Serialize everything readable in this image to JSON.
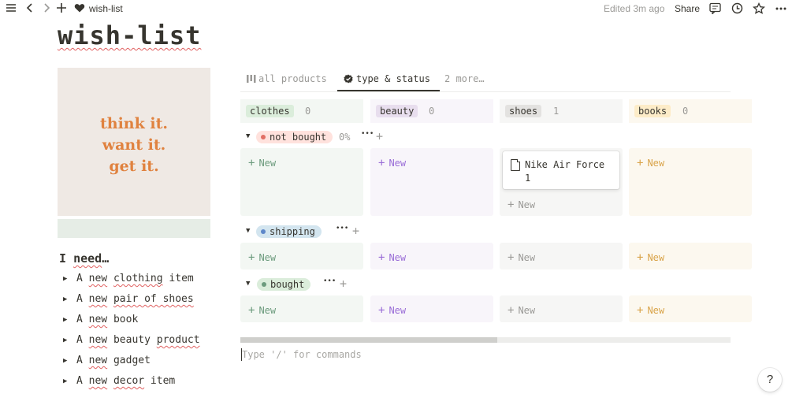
{
  "topbar": {
    "menu_icon": "hamburger-icon",
    "back_icon": "chevron-left-icon",
    "forward_icon": "chevron-right-icon",
    "add_icon": "plus-icon",
    "breadcrumb_icon": "heart-icon",
    "breadcrumb": "wish-list",
    "edited": "Edited 3m ago",
    "share": "Share",
    "comment_icon": "comment-icon",
    "history_icon": "clock-icon",
    "favorite_icon": "star-icon",
    "more_icon": "more-icon"
  },
  "page": {
    "title": "wish-list",
    "cover_lines": [
      "think it.",
      "want it.",
      "get it."
    ],
    "cover_color": "#e0823f"
  },
  "need": {
    "heading_prefix": "I ",
    "heading_word": "need",
    "heading_suffix": "…",
    "items": [
      {
        "a": "A ",
        "b": "new",
        "c": " ",
        "d": "clothing",
        "e": " item"
      },
      {
        "a": "A ",
        "b": "new",
        "c": " ",
        "d": "pair of shoes",
        "e": ""
      },
      {
        "a": "A ",
        "b": "new",
        "c": " book",
        "d": "",
        "e": ""
      },
      {
        "a": "A ",
        "b": "new",
        "c": " beauty ",
        "d": "product",
        "e": ""
      },
      {
        "a": "A ",
        "b": "new",
        "c": " gadget",
        "d": "",
        "e": ""
      },
      {
        "a": "A ",
        "b": "new",
        "c": " ",
        "d": "decor",
        "e": " item"
      }
    ]
  },
  "tabs": [
    {
      "label": "all products",
      "icon": "board-icon"
    },
    {
      "label": "type & status",
      "icon": "check-badge-icon"
    },
    {
      "label": "2 more…",
      "icon": ""
    }
  ],
  "columns": [
    {
      "label": "clothes",
      "count": "0",
      "pill": "#dbeddb",
      "bg": "#f3f7f3",
      "accent": "#6c9b7d"
    },
    {
      "label": "beauty",
      "count": "0",
      "pill": "#e8deee",
      "bg": "#f8f5fa",
      "accent": "#9a6dd7"
    },
    {
      "label": "shoes",
      "count": "1",
      "pill": "#e3e2e0",
      "bg": "#f6f6f5",
      "accent": "#9b9a97"
    },
    {
      "label": "books",
      "count": "0",
      "pill": "#fdecc8",
      "bg": "#fcf8ef",
      "accent": "#d9a44a"
    }
  ],
  "groups": [
    {
      "label": "not bought",
      "pct": "0%",
      "pill": "#ffe2dd",
      "dot": "#e16f64"
    },
    {
      "label": "shipping",
      "pct": "",
      "pill": "#d3e5ef",
      "dot": "#5e87c9"
    },
    {
      "label": "bought",
      "pct": "",
      "pill": "#dbeddb",
      "dot": "#6c9b7d"
    }
  ],
  "card": {
    "title": "Nike Air Force 1",
    "icon": "page-icon"
  },
  "new_label": "New",
  "group_more": "•••",
  "group_add": "+",
  "command_placeholder": "Type '/' for commands",
  "help": "?"
}
